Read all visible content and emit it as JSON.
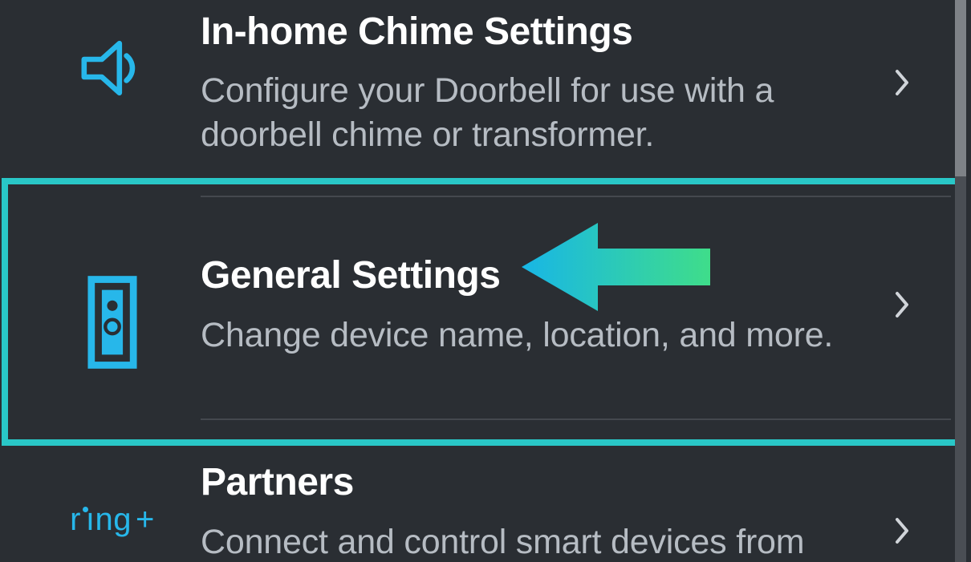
{
  "rows": [
    {
      "id": "chime",
      "title": "In-home Chime Settings",
      "subtitle": "Configure your Doorbell for use with a doorbell chime or transformer.",
      "icon": "speaker-icon"
    },
    {
      "id": "general",
      "title": "General Settings",
      "subtitle": "Change device name, location, and more.",
      "icon": "doorbell-icon",
      "highlighted": true
    },
    {
      "id": "partners",
      "title": "Partners",
      "subtitle": "Connect and control smart devices from",
      "icon": "ringplus-icon"
    }
  ],
  "accent_color": "#27b7ea",
  "highlight_color": "#29c7c7"
}
